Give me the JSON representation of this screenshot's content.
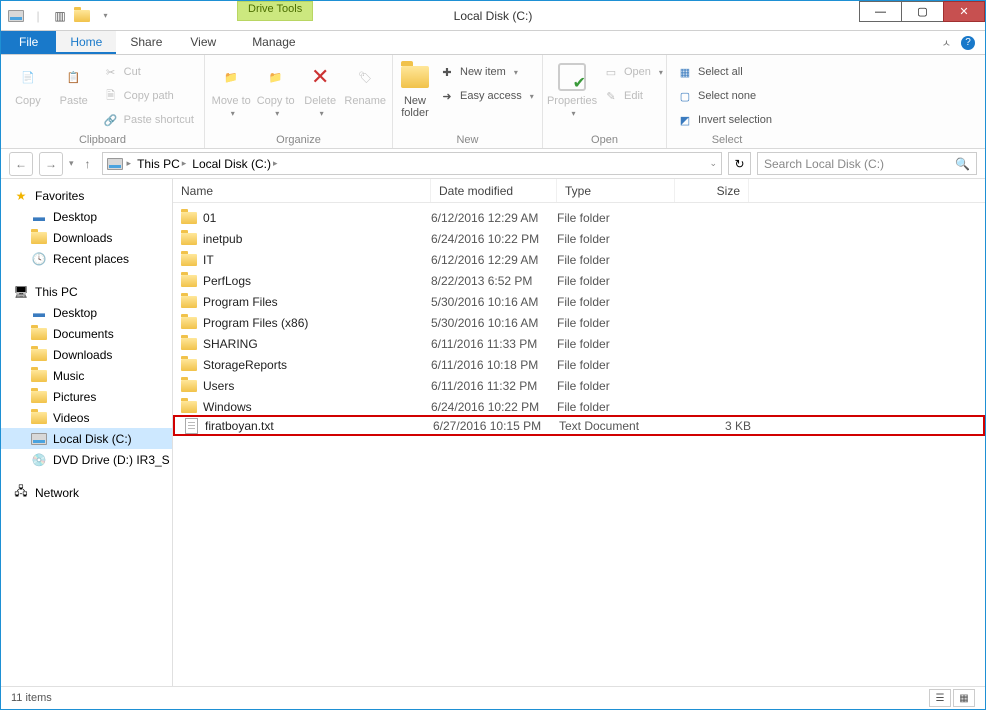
{
  "window": {
    "title": "Local Disk (C:)",
    "drivetools": "Drive Tools"
  },
  "tabs": {
    "file": "File",
    "home": "Home",
    "share": "Share",
    "view": "View",
    "manage": "Manage"
  },
  "ribbon": {
    "clipboard": {
      "label": "Clipboard",
      "copy": "Copy",
      "paste": "Paste",
      "cut": "Cut",
      "copypath": "Copy path",
      "pasteshortcut": "Paste shortcut"
    },
    "organize": {
      "label": "Organize",
      "moveto": "Move\nto",
      "copyto": "Copy\nto",
      "delete": "Delete",
      "rename": "Rename"
    },
    "new": {
      "label": "New",
      "newfolder": "New\nfolder",
      "newitem": "New item",
      "easyaccess": "Easy access"
    },
    "open": {
      "label": "Open",
      "properties": "Properties",
      "open": "Open",
      "edit": "Edit"
    },
    "select": {
      "label": "Select",
      "all": "Select all",
      "none": "Select none",
      "invert": "Invert selection"
    }
  },
  "breadcrumb": {
    "thispc": "This PC",
    "disk": "Local Disk (C:)"
  },
  "search": {
    "placeholder": "Search Local Disk (C:)"
  },
  "tree": {
    "favorites": "Favorites",
    "desktop": "Desktop",
    "downloads": "Downloads",
    "recent": "Recent places",
    "thispc": "This PC",
    "desktop2": "Desktop",
    "documents": "Documents",
    "downloads2": "Downloads",
    "music": "Music",
    "pictures": "Pictures",
    "videos": "Videos",
    "localdisk": "Local Disk (C:)",
    "dvd": "DVD Drive (D:) IR3_S",
    "network": "Network"
  },
  "columns": {
    "name": "Name",
    "date": "Date modified",
    "type": "Type",
    "size": "Size"
  },
  "files": [
    {
      "icon": "folder",
      "name": "01",
      "date": "6/12/2016 12:29 AM",
      "type": "File folder",
      "size": ""
    },
    {
      "icon": "folder",
      "name": "inetpub",
      "date": "6/24/2016 10:22 PM",
      "type": "File folder",
      "size": ""
    },
    {
      "icon": "folder",
      "name": "IT",
      "date": "6/12/2016 12:29 AM",
      "type": "File folder",
      "size": ""
    },
    {
      "icon": "folder",
      "name": "PerfLogs",
      "date": "8/22/2013 6:52 PM",
      "type": "File folder",
      "size": ""
    },
    {
      "icon": "folder",
      "name": "Program Files",
      "date": "5/30/2016 10:16 AM",
      "type": "File folder",
      "size": ""
    },
    {
      "icon": "folder",
      "name": "Program Files (x86)",
      "date": "5/30/2016 10:16 AM",
      "type": "File folder",
      "size": ""
    },
    {
      "icon": "folder",
      "name": "SHARING",
      "date": "6/11/2016 11:33 PM",
      "type": "File folder",
      "size": ""
    },
    {
      "icon": "folder",
      "name": "StorageReports",
      "date": "6/11/2016 10:18 PM",
      "type": "File folder",
      "size": ""
    },
    {
      "icon": "folder",
      "name": "Users",
      "date": "6/11/2016 11:32 PM",
      "type": "File folder",
      "size": ""
    },
    {
      "icon": "folder",
      "name": "Windows",
      "date": "6/24/2016 10:22 PM",
      "type": "File folder",
      "size": ""
    },
    {
      "icon": "txt",
      "name": "firatboyan.txt",
      "date": "6/27/2016 10:15 PM",
      "type": "Text Document",
      "size": "3 KB",
      "hl": true
    }
  ],
  "status": {
    "count": "11 items"
  }
}
